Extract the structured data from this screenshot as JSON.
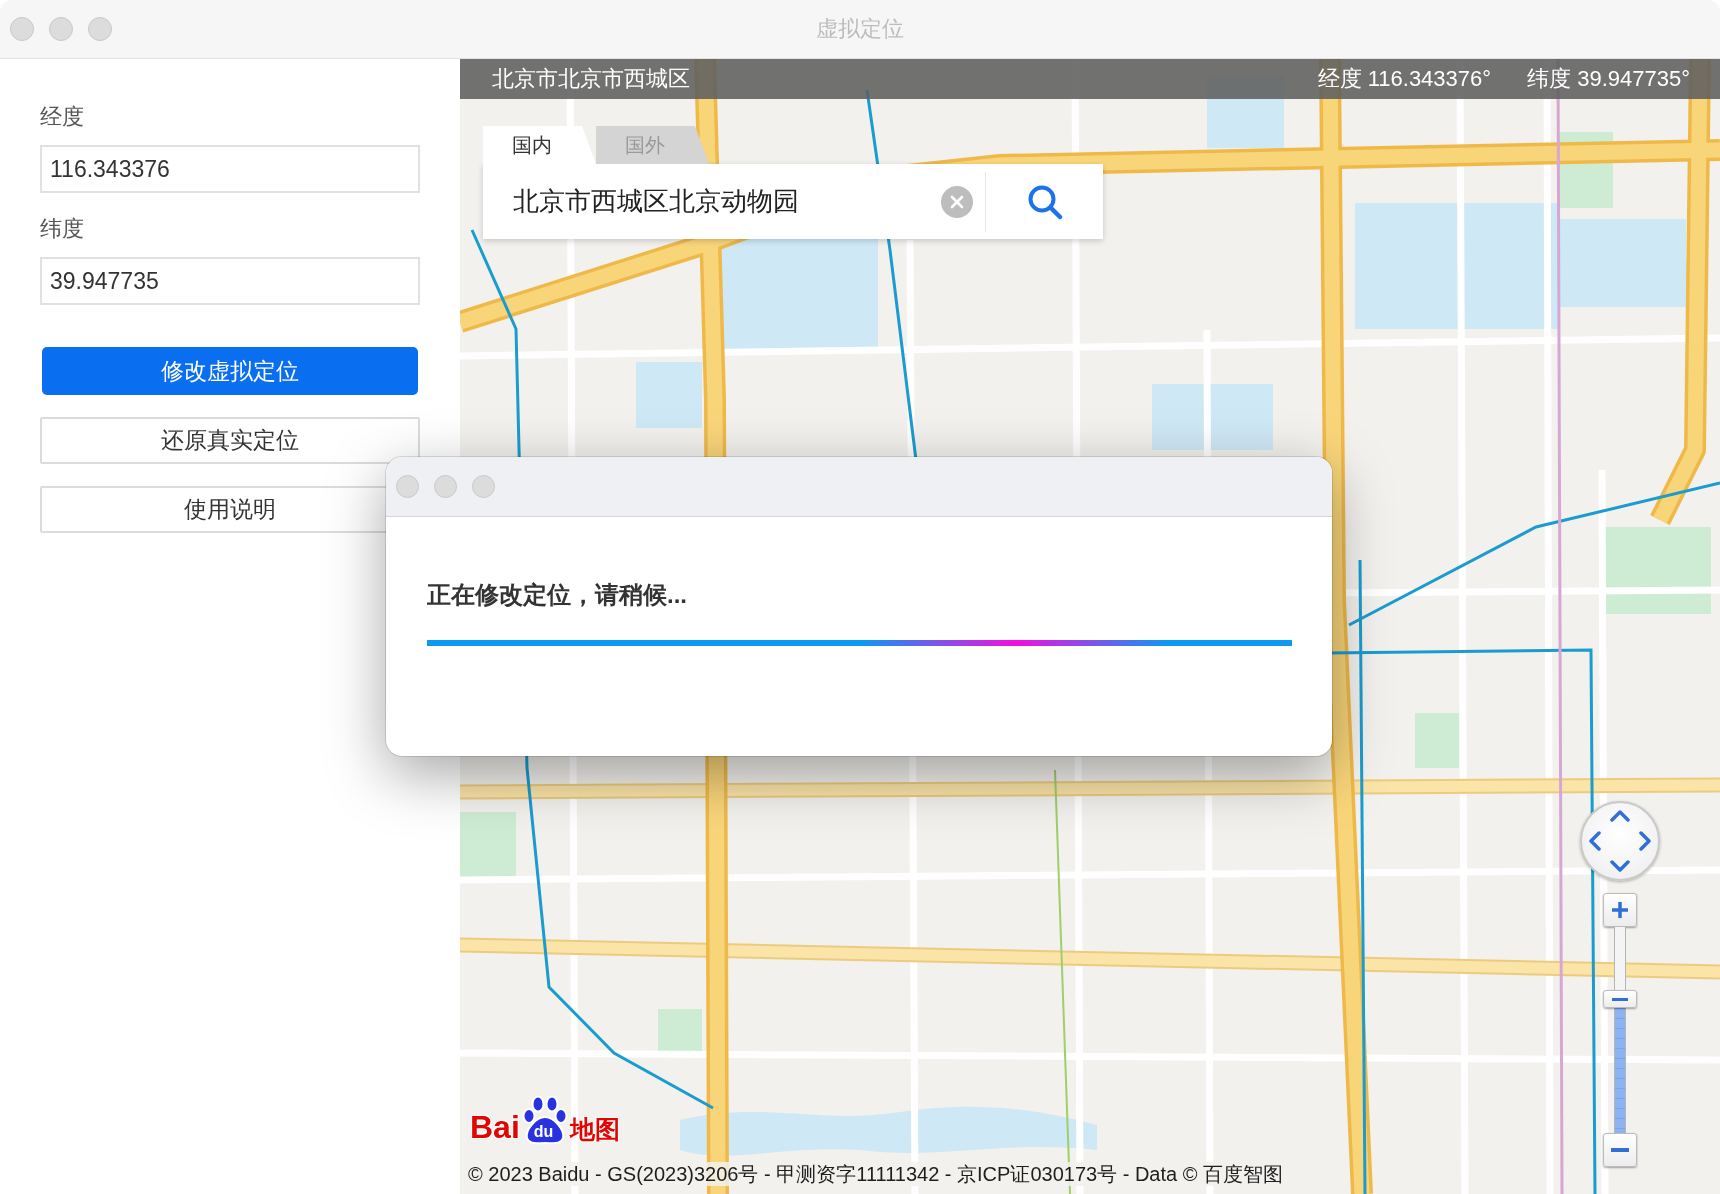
{
  "window": {
    "title": "虚拟定位"
  },
  "form": {
    "fields": [
      {
        "label": "经度",
        "value": "116.343376"
      },
      {
        "label": "纬度",
        "value": "39.947735"
      }
    ],
    "buttons": [
      {
        "label": "修改虚拟定位",
        "kind": "primary"
      },
      {
        "label": "还原真实定位",
        "kind": "default"
      },
      {
        "label": "使用说明",
        "kind": "default"
      }
    ]
  },
  "map": {
    "address_bar": {
      "address": "北京市北京市西城区",
      "coordinates": [
        "经度 116.343376°",
        "纬度 39.947735°"
      ]
    },
    "search": {
      "tabs": [
        {
          "label": "国内",
          "selected": true
        },
        {
          "label": "国外",
          "selected": false
        }
      ],
      "query": "北京市西城区北京动物园"
    },
    "zoom": {
      "level": 0.65
    },
    "logo": {
      "left": "Bai",
      "paw": "du",
      "right": "地图"
    },
    "copyright": "© 2023 Baidu - GS(2023)3206号 - 甲测资字11111342 - 京ICP证030173号 - Data © 百度智图"
  },
  "dialog": {
    "message": "正在修改定位，请稍候...",
    "progress": {
      "indeterminate": true
    }
  }
}
